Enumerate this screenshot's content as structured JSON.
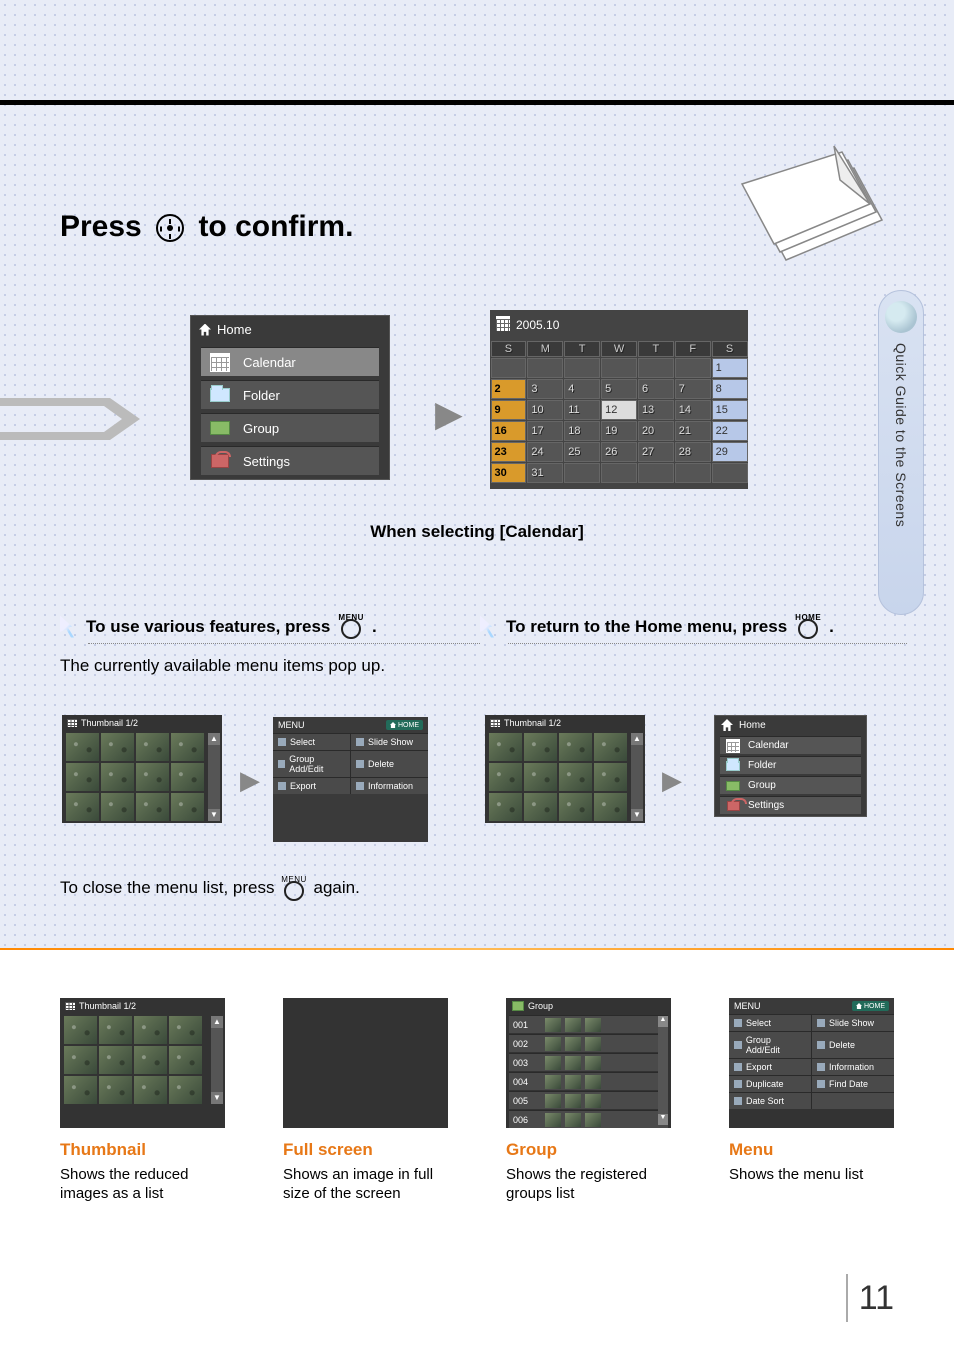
{
  "page_number": "11",
  "side_tab": "Quick Guide to the Screens",
  "heading1_a": "Press",
  "heading1_b": "to confirm.",
  "home_menu": {
    "title": "Home",
    "items": [
      "Calendar",
      "Folder",
      "Group",
      "Settings"
    ]
  },
  "calendar": {
    "title": "2005.10",
    "day_headers": [
      "S",
      "M",
      "T",
      "W",
      "T",
      "F",
      "S"
    ],
    "weeks": [
      [
        "",
        "",
        "",
        "",
        "",
        "",
        "1"
      ],
      [
        "2",
        "3",
        "4",
        "5",
        "6",
        "7",
        "8"
      ],
      [
        "9",
        "10",
        "11",
        "12",
        "13",
        "14",
        "15"
      ],
      [
        "16",
        "17",
        "18",
        "19",
        "20",
        "21",
        "22"
      ],
      [
        "23",
        "24",
        "25",
        "26",
        "27",
        "28",
        "29"
      ],
      [
        "30",
        "31",
        "",
        "",
        "",
        "",
        ""
      ]
    ]
  },
  "caption_calendar": "When selecting [Calendar]",
  "tip_left_a": "To use various features, press",
  "tip_left_b": ".",
  "tip_left_btn": "MENU",
  "tip_right_a": "To return to the Home menu, press",
  "tip_right_b": ".",
  "tip_right_btn": "HOME",
  "para_popup": "The currently available menu items pop up.",
  "para_close_a": "To close the menu list, press",
  "para_close_b": "again.",
  "para_close_btn": "MENU",
  "thumb_title": "Thumbnail 1/2",
  "mini_menu": {
    "title": "MENU",
    "home": "HOME",
    "rows": [
      [
        "Select",
        "Slide Show"
      ],
      [
        "Group Add/Edit",
        "Delete"
      ],
      [
        "Export",
        "Information"
      ]
    ],
    "rows_full": [
      [
        "Select",
        "Slide Show"
      ],
      [
        "Group Add/Edit",
        "Delete"
      ],
      [
        "Export",
        "Information"
      ],
      [
        "Duplicate",
        "Find Date"
      ],
      [
        "Date Sort",
        ""
      ]
    ]
  },
  "group_list": {
    "title": "Group",
    "rows": [
      "001",
      "002",
      "003",
      "004",
      "005",
      "006"
    ]
  },
  "cards": [
    {
      "title": "Thumbnail",
      "desc": "Shows the reduced images as a list"
    },
    {
      "title": "Full screen",
      "desc": "Shows an image in full size of the screen"
    },
    {
      "title": "Group",
      "desc": "Shows the registered groups list"
    },
    {
      "title": "Menu",
      "desc": "Shows the menu list"
    }
  ]
}
